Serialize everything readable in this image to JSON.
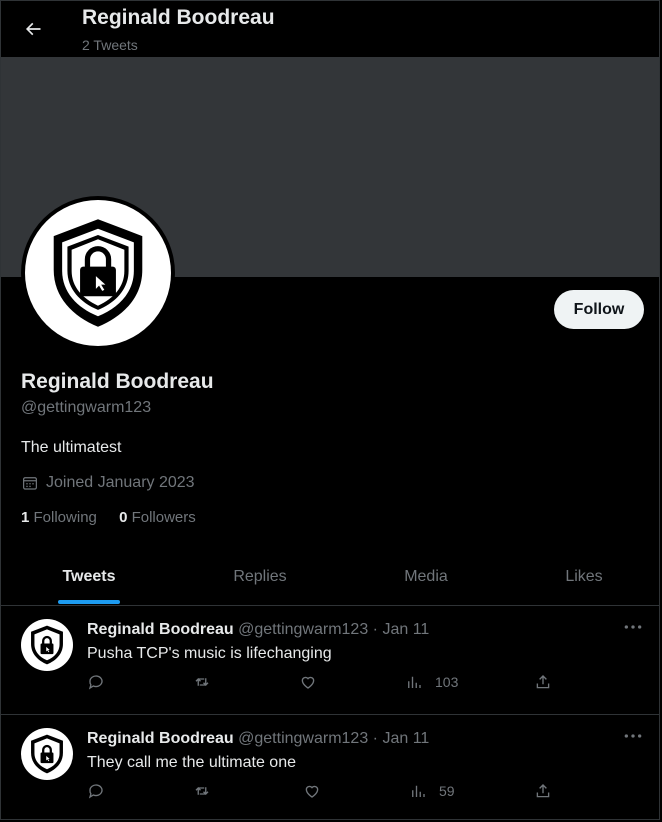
{
  "header": {
    "title": "Reginald Boodreau",
    "subtitle": "2 Tweets"
  },
  "profile": {
    "follow_label": "Follow",
    "name": "Reginald Boodreau",
    "handle": "@gettingwarm123",
    "bio": "The ultimatest",
    "joined": "Joined January 2023",
    "following_count": "1",
    "following_label": "Following",
    "followers_count": "0",
    "followers_label": "Followers",
    "avatar_icon": "shield-lock-cursor-icon"
  },
  "tabs": [
    {
      "label": "Tweets",
      "active": true
    },
    {
      "label": "Replies"
    },
    {
      "label": "Media"
    },
    {
      "label": "Likes"
    }
  ],
  "tweets": [
    {
      "name": "Reginald Boodreau",
      "sub": "@gettingwarm123 · Jan 11",
      "text": "Pusha TCP's music is lifechanging",
      "views": "103"
    },
    {
      "name": "Reginald Boodreau",
      "sub": "@gettingwarm123 · Jan 11",
      "text": "They call me the ultimate one",
      "views": "59"
    }
  ],
  "colors": {
    "accent": "#1d9bf0",
    "banner": "#333639",
    "muted": "#71767b"
  }
}
